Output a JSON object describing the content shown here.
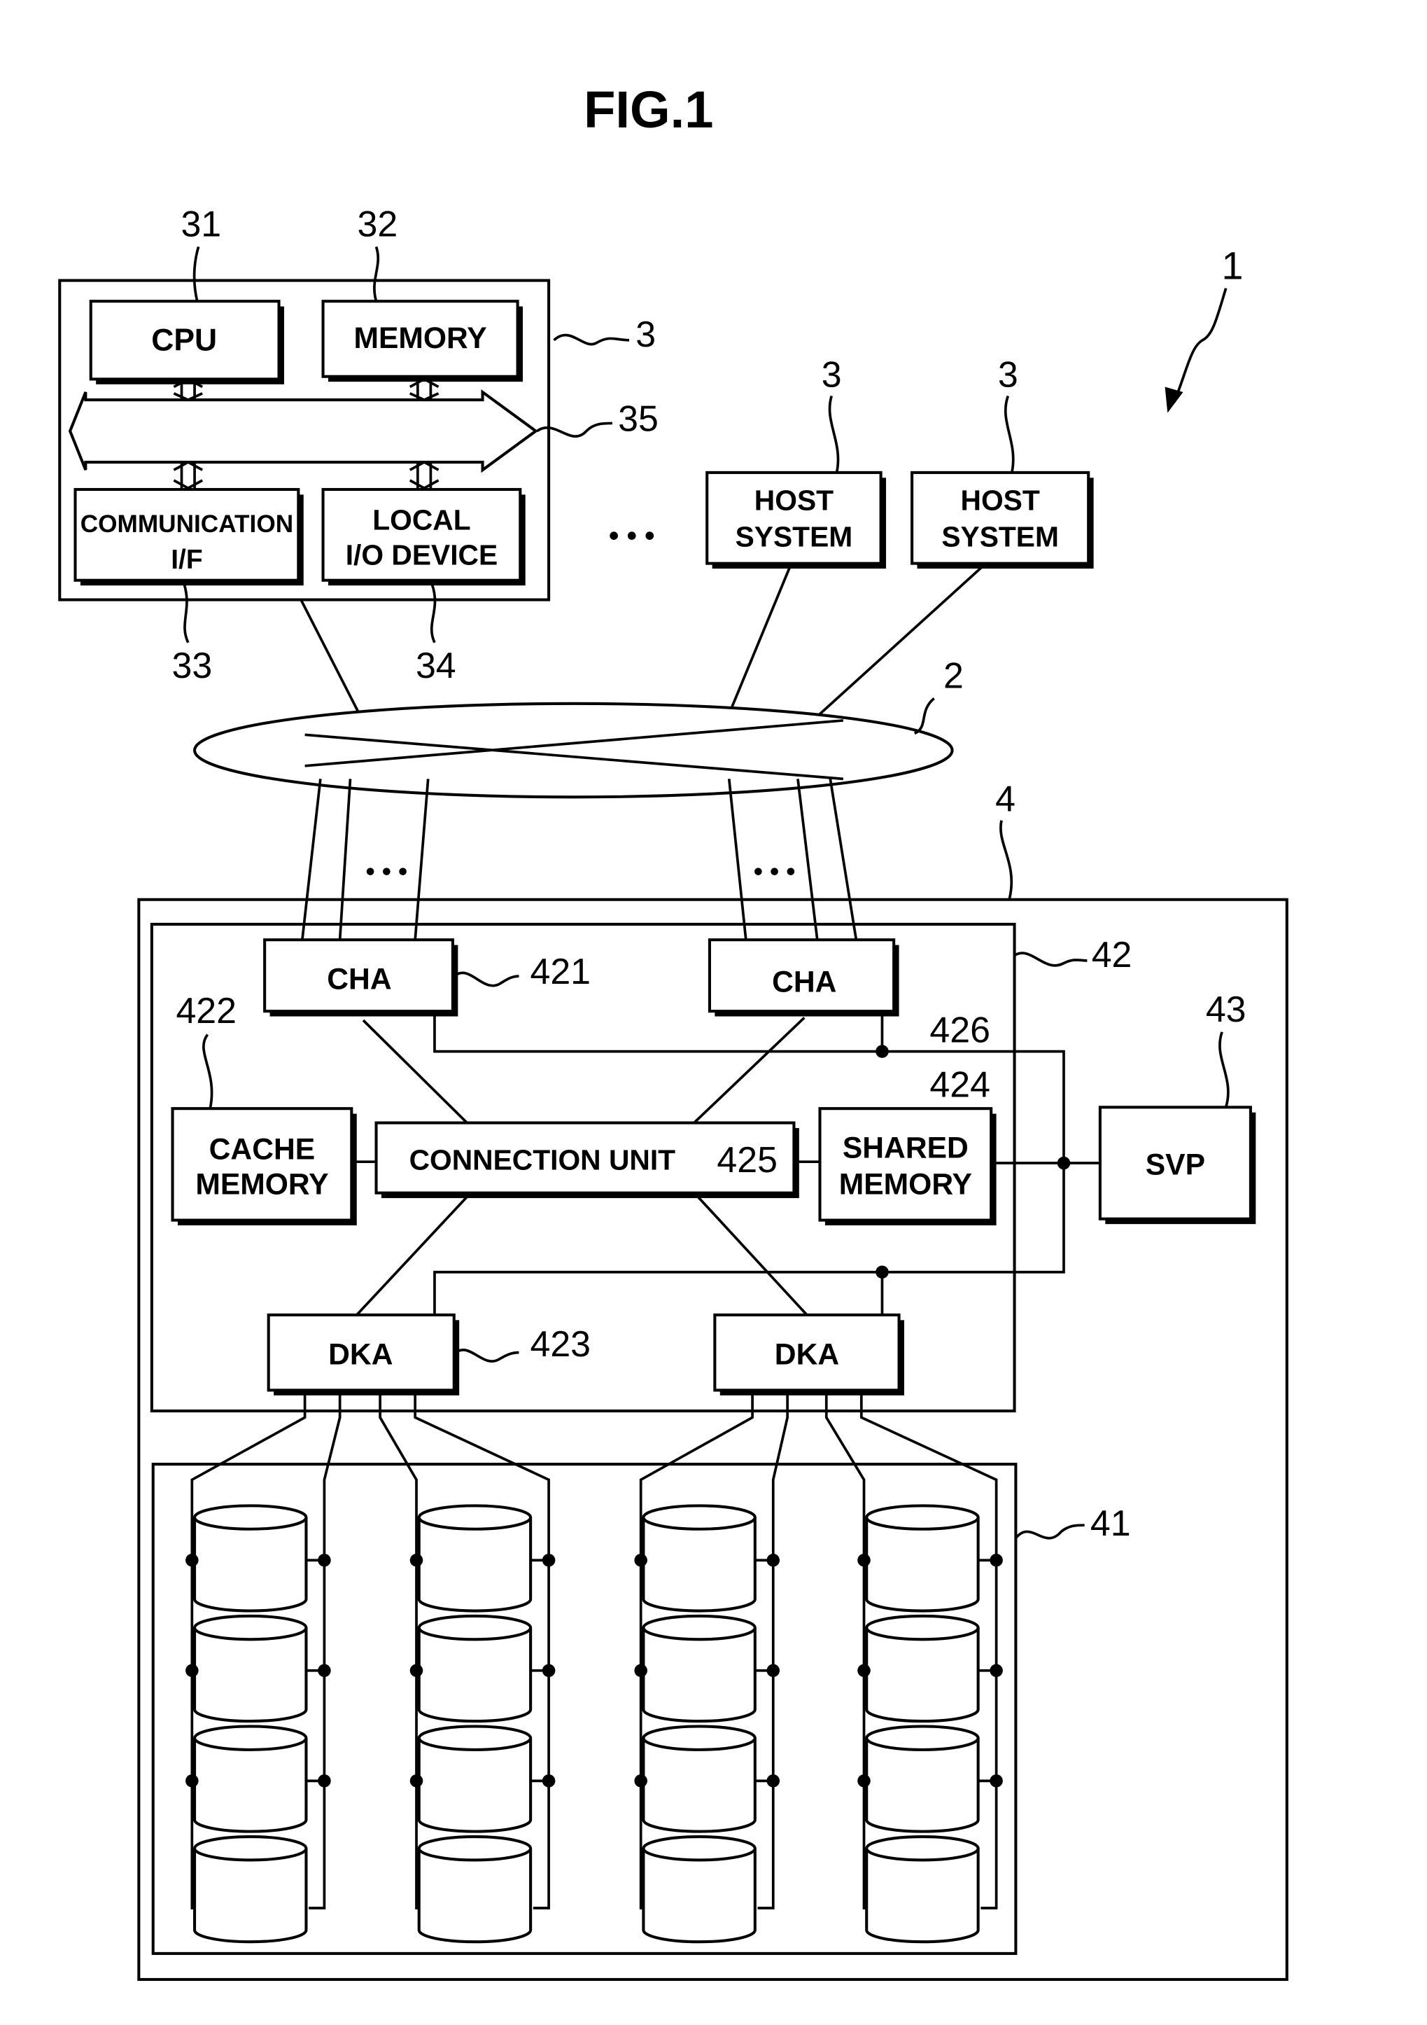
{
  "figure": {
    "title": "FIG.1",
    "system_ref": "1"
  },
  "host_detail": {
    "ref": "3",
    "cpu": {
      "label": "CPU",
      "ref": "31"
    },
    "memory": {
      "label": "MEMORY",
      "ref": "32"
    },
    "comm_if": {
      "label_line1": "COMMUNICATION",
      "label_line2": "I/F",
      "ref": "33"
    },
    "local_io": {
      "label_line1": "LOCAL",
      "label_line2": "I/O DEVICE",
      "ref": "34"
    },
    "bus_ref": "35"
  },
  "hosts": [
    {
      "label_line1": "HOST",
      "label_line2": "SYSTEM",
      "ref": "3"
    },
    {
      "label_line1": "HOST",
      "label_line2": "SYSTEM",
      "ref": "3"
    }
  ],
  "ellipsis": "• • •",
  "network": {
    "ref": "2"
  },
  "storage_system": {
    "ref": "4",
    "controller": {
      "ref": "42",
      "cha": [
        {
          "label": "CHA",
          "ref": "421"
        },
        {
          "label": "CHA",
          "ref": ""
        }
      ],
      "cache_memory": {
        "label_line1": "CACHE",
        "label_line2": "MEMORY",
        "ref": "422"
      },
      "connection_unit": {
        "label": "CONNECTION UNIT",
        "ref": "425"
      },
      "shared_memory": {
        "label_line1": "SHARED",
        "label_line2": "MEMORY",
        "ref": "424"
      },
      "internal_lan_ref": "426",
      "dka": [
        {
          "label": "DKA",
          "ref": "423"
        },
        {
          "label": "DKA",
          "ref": ""
        }
      ]
    },
    "svp": {
      "label": "SVP",
      "ref": "43"
    },
    "disk_array": {
      "ref": "41",
      "columns": 4,
      "rows": 4
    }
  }
}
